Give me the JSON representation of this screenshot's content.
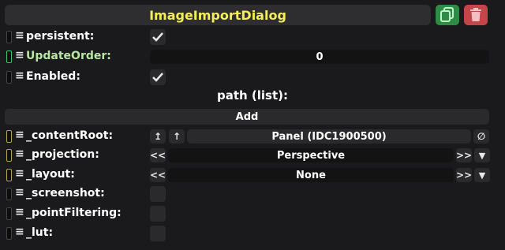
{
  "header": {
    "title": "ImageImportDialog",
    "copy_icon": "copy-icon",
    "delete_icon": "trash-icon"
  },
  "rows": {
    "persistent": {
      "label": "persistent:",
      "checked": true
    },
    "update_order": {
      "label": "UpdateOrder:",
      "value": "0"
    },
    "enabled": {
      "label": "Enabled:",
      "checked": true
    }
  },
  "list": {
    "title": "path (list):",
    "add_label": "Add"
  },
  "fields": {
    "content_root": {
      "label": "_contentRoot:",
      "value": "Panel (IDC1900500)",
      "btn_a": "↥",
      "btn_b": "↑",
      "clear": "∅"
    },
    "projection": {
      "label": "_projection:",
      "value": "Perspective",
      "prev": "<<",
      "next": ">>",
      "dropdown": "▼"
    },
    "layout": {
      "label": "_layout:",
      "value": "None",
      "prev": "<<",
      "next": ">>",
      "dropdown": "▼"
    },
    "screenshot": {
      "label": "_screenshot:",
      "checked": false
    },
    "point_filtering": {
      "label": "_pointFiltering:",
      "checked": false
    },
    "lut": {
      "label": "_lut:",
      "checked": false
    }
  },
  "menu_glyph": "≡",
  "colors": {
    "title": "#f5ee57",
    "green_accent": "#3ac46c",
    "delete": "#c4454a",
    "copy": "#2f8c47"
  }
}
